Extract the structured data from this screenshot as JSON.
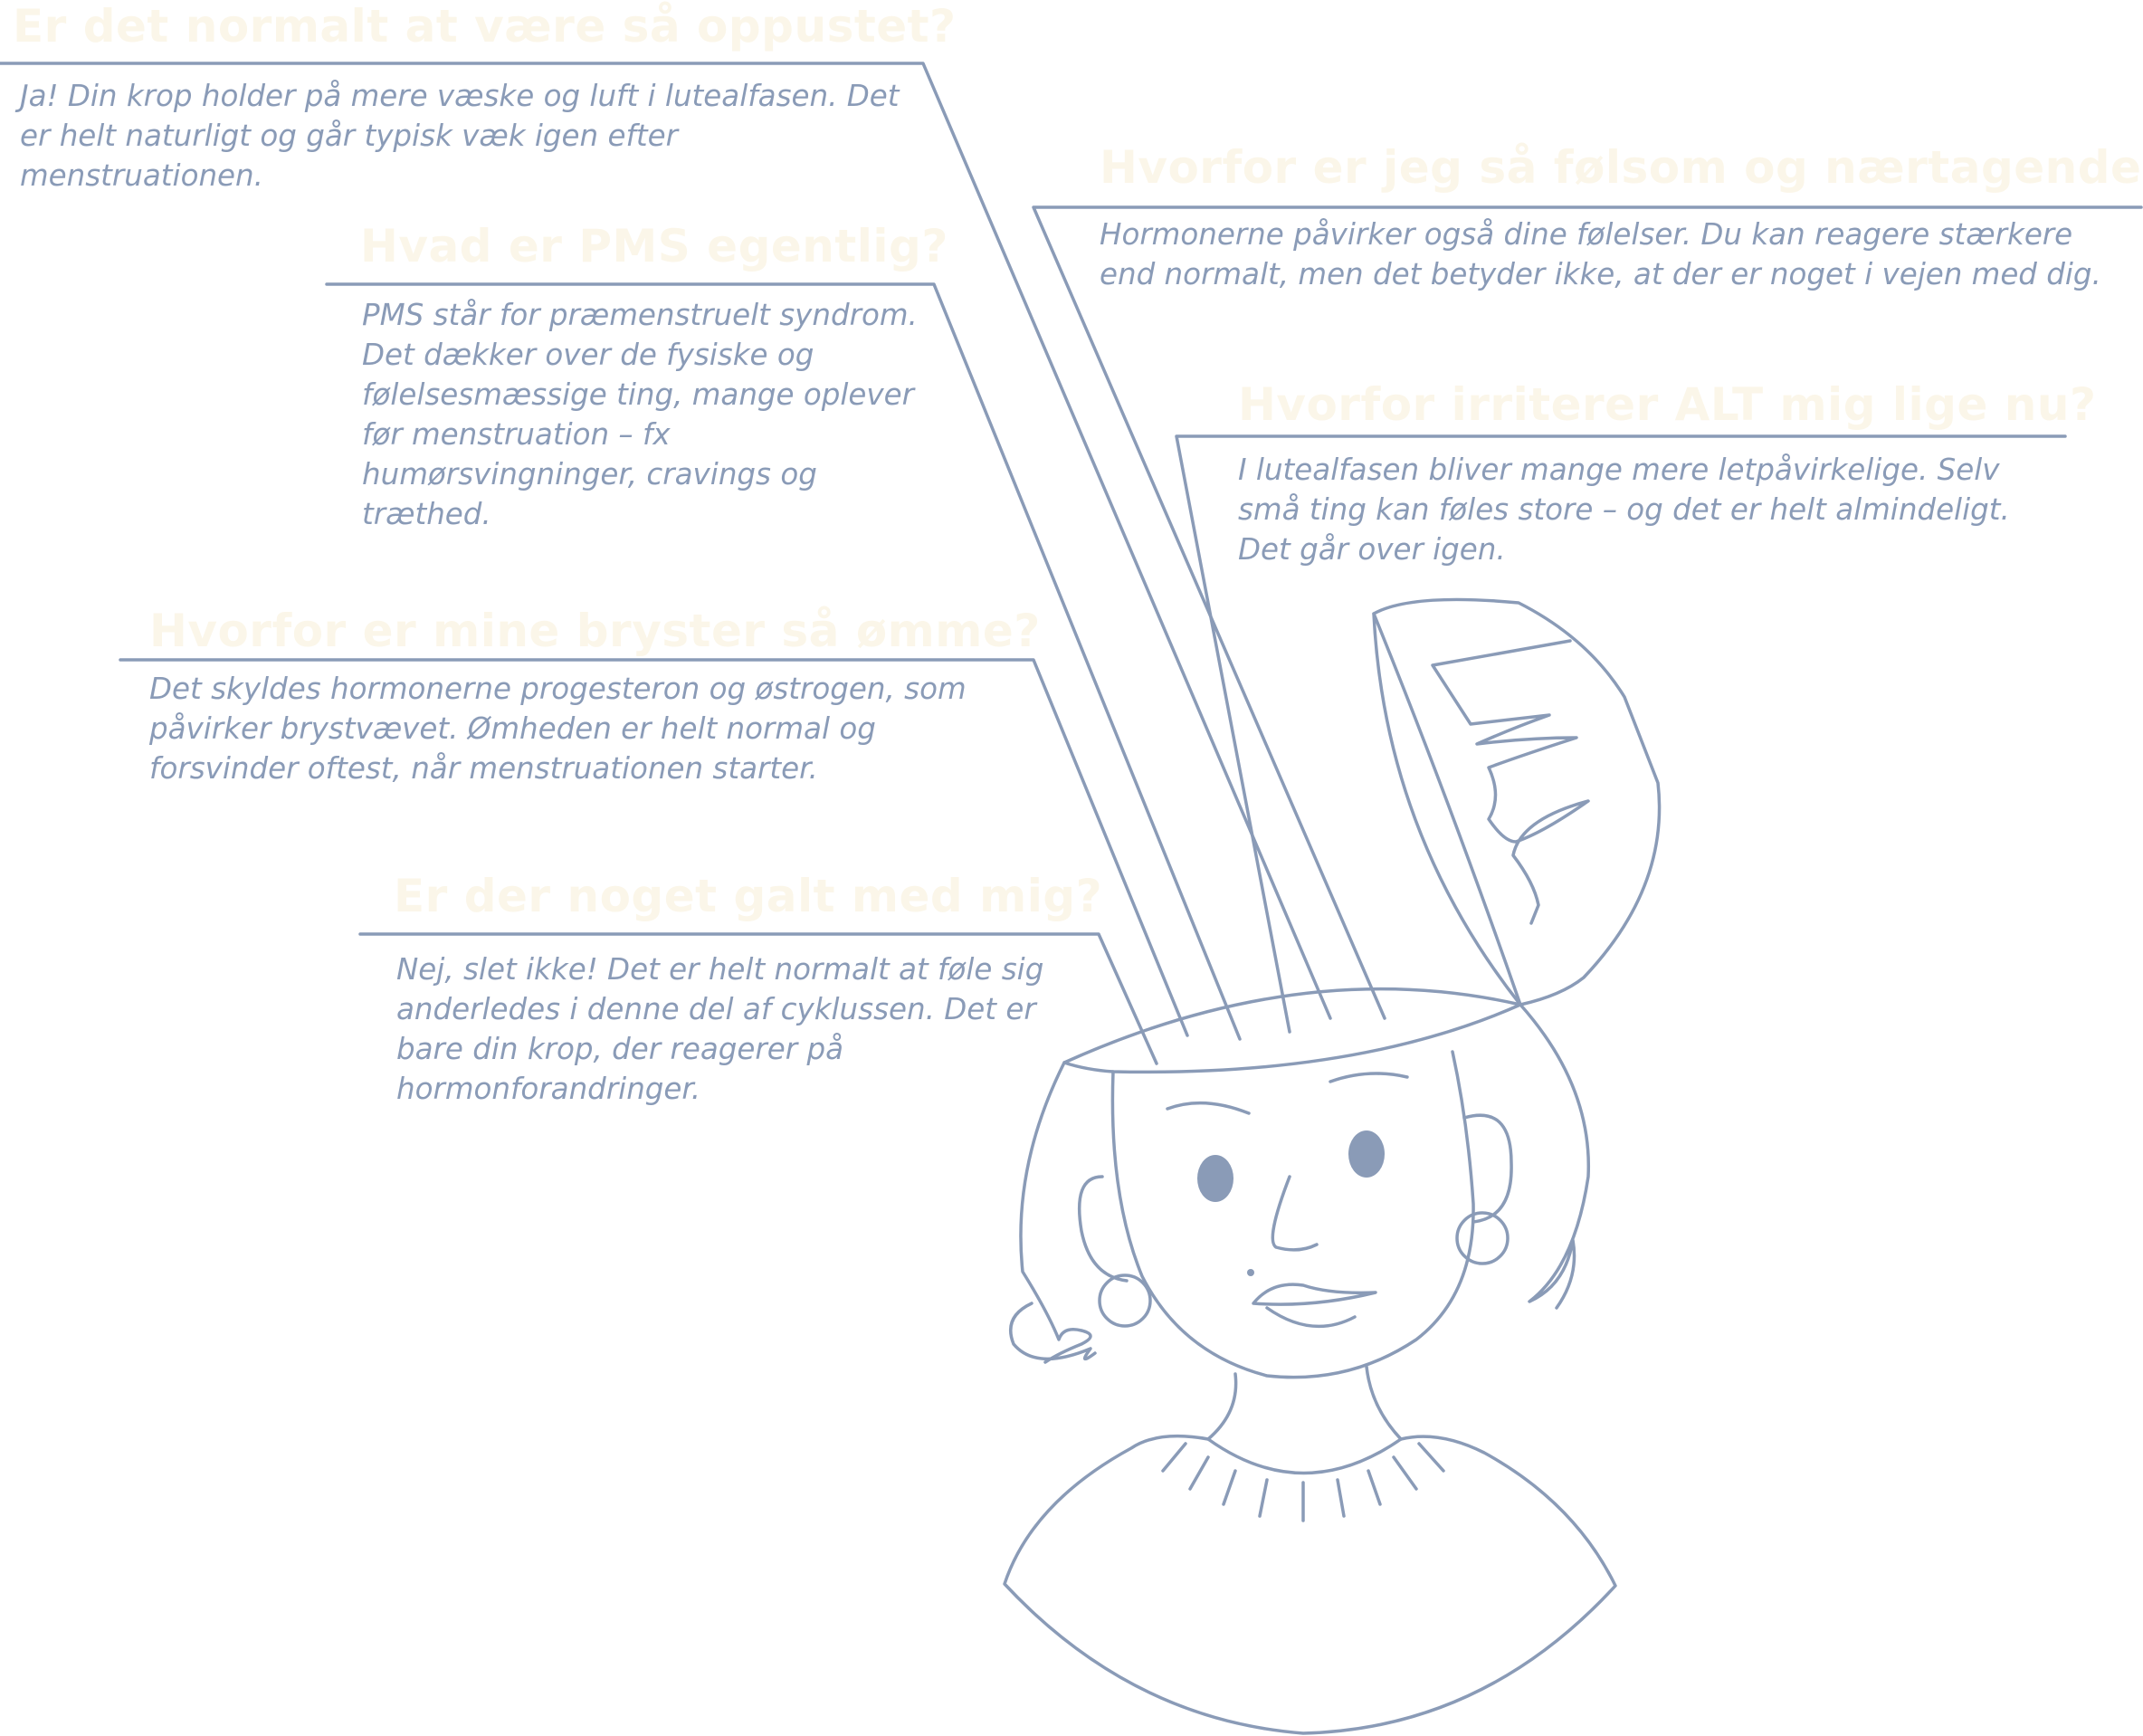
{
  "colors": {
    "line": "#8a9bb7",
    "question": "#fbf6e9",
    "background": "#ffffff"
  },
  "callouts": [
    {
      "question": "Er det normalt at være så oppustet?",
      "answer": "Ja! Din krop holder på mere væske og luft i lutealfasen. Det er helt naturligt og går typisk væk igen efter menstruationen."
    },
    {
      "question": "Hvorfor er jeg så følsom og nærtagende?",
      "answer": "Hormonerne påvirker også dine følelser. Du kan reagere stærkere end normalt, men det betyder ikke, at der er noget i vejen med dig."
    },
    {
      "question": "Hvad er PMS egentlig?",
      "answer": "PMS står for præmenstruelt syndrom. Det dækker over de fysiske og følelsesmæssige ting, mange oplever før menstruation – fx humørsvingninger, cravings og træthed."
    },
    {
      "question": "Hvorfor irriterer ALT mig lige nu?",
      "answer": "I lutealfasen bliver mange mere letpåvirkelige. Selv små ting kan føles store – og det er helt almindeligt. Det går over igen."
    },
    {
      "question": "Hvorfor er mine bryster så ømme?",
      "answer": "Det skyldes hormonerne progesteron og østrogen, som påvirker brystvævet. Ømheden er helt normal og forsvinder oftest, når menstruationen starter."
    },
    {
      "question": "Er der noget galt med mig?",
      "answer": "Nej, slet ikke! Det er helt normalt at føle sig anderledes i denne del af cyklussen. Det er bare din krop, der reagerer på hormonforandringer."
    }
  ]
}
